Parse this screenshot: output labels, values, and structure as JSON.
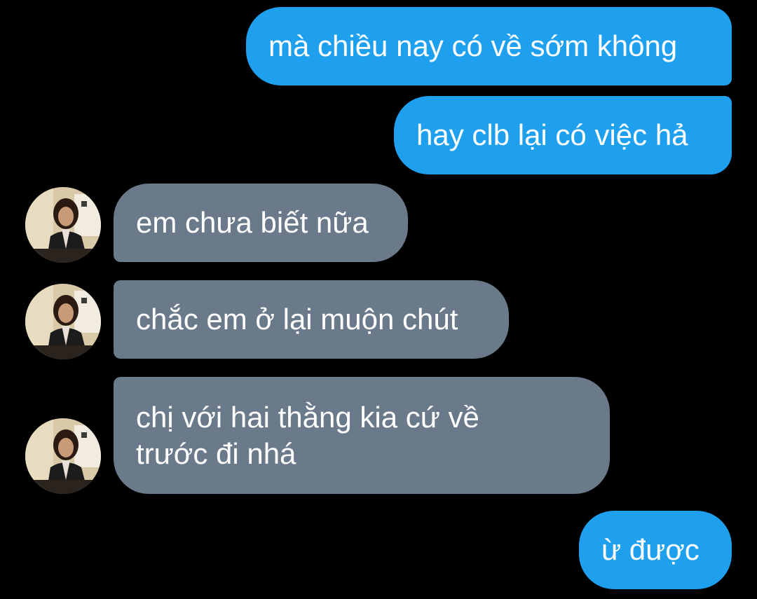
{
  "conversation": {
    "messages": [
      {
        "sender": "me",
        "text": "mà chiều nay có về sớm không"
      },
      {
        "sender": "me",
        "text": "hay clb lại có việc hả"
      },
      {
        "sender": "contact",
        "text": "em chưa biết nữa"
      },
      {
        "sender": "contact",
        "text": "chắc em ở lại muộn chút"
      },
      {
        "sender": "contact",
        "text_lines": [
          "chị với hai thằng kia cứ về",
          "trước đi nhá"
        ]
      },
      {
        "sender": "me",
        "text": "ừ được"
      }
    ],
    "colors": {
      "background": "#000000",
      "sent_bubble": "#1fa0ef",
      "received_bubble": "#6a7a8a",
      "text": "#ffffff"
    },
    "contact_avatar_icon": "profile-photo-avatar"
  }
}
